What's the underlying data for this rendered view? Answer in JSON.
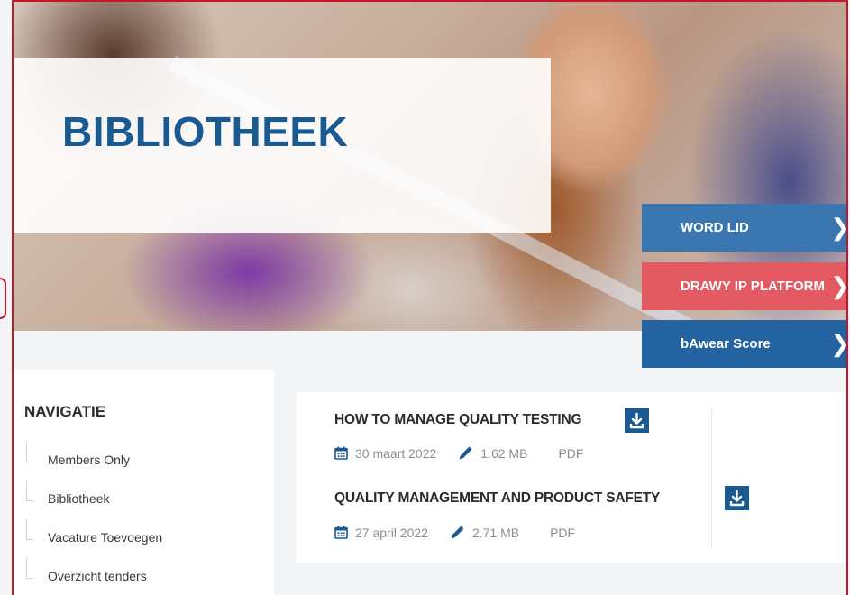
{
  "hero": {
    "title": "BIBLIOTHEEK"
  },
  "side_buttons": [
    {
      "label": "WORD LID",
      "color": "#3a77b1"
    },
    {
      "label": "DRAWY IP PLATFORM",
      "color": "#e35a62"
    },
    {
      "label": "bAwear Score",
      "color": "#2463a1"
    }
  ],
  "navigation": {
    "title": "NAVIGATIE",
    "items": [
      {
        "label": "Members Only"
      },
      {
        "label": "Bibliotheek"
      },
      {
        "label": "Vacature Toevoegen"
      },
      {
        "label": "Overzicht tenders"
      }
    ]
  },
  "files": [
    {
      "title": "HOW TO MANAGE QUALITY TESTING",
      "date": "30 maart 2022",
      "size": "1.62 MB",
      "type": "PDF"
    },
    {
      "title": "QUALITY MANAGEMENT AND PRODUCT SAFETY",
      "date": "27 april 2022",
      "size": "2.71 MB",
      "type": "PDF"
    }
  ],
  "icons": {
    "download": "download-icon",
    "calendar": "calendar-icon",
    "size": "pencil-icon",
    "chevron": "chevron-right-icon"
  },
  "colors": {
    "brand_blue": "#1a5a91",
    "accent_red": "#e35a62",
    "frame_red": "#c0192b"
  }
}
